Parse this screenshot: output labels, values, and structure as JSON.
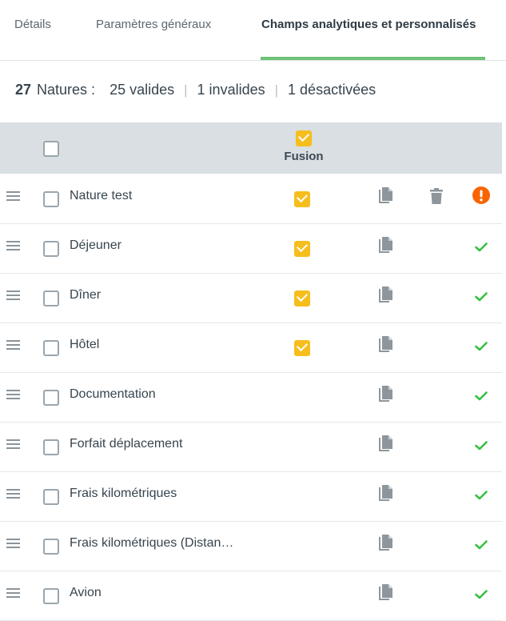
{
  "tabs": [
    {
      "label": "Détails"
    },
    {
      "label": "Paramètres généraux"
    },
    {
      "label": "Champs analytiques et personnalisés",
      "active": true
    }
  ],
  "stats": {
    "count": "27",
    "label": "Natures :",
    "valid": "25 valides",
    "invalid": "1 invalides",
    "disabled": "1 désactivées"
  },
  "table": {
    "fusion_header": "Fusion",
    "fusion_header_checked": true,
    "select_all_checked": false
  },
  "rows": [
    {
      "name": "Nature test",
      "fusion": true,
      "status": "error",
      "deletable": true
    },
    {
      "name": "Déjeuner",
      "fusion": true,
      "status": "valid"
    },
    {
      "name": "Dîner",
      "fusion": true,
      "status": "valid"
    },
    {
      "name": "Hôtel",
      "fusion": true,
      "status": "valid"
    },
    {
      "name": "Documentation",
      "fusion": false,
      "status": "valid"
    },
    {
      "name": "Forfait déplacement",
      "fusion": false,
      "status": "valid"
    },
    {
      "name": "Frais kilométriques",
      "fusion": false,
      "status": "valid"
    },
    {
      "name": "Frais kilométriques (Distan…",
      "fusion": false,
      "status": "valid"
    },
    {
      "name": "Avion",
      "fusion": false,
      "status": "valid"
    }
  ],
  "colors": {
    "accent": "#6cc276",
    "checkbox_checked": "#f6be1d",
    "error": "#fa6400",
    "valid": "#37c143",
    "header_bg": "#d9dfe2"
  },
  "icons": {
    "drag": "drag-handle-icon",
    "copy": "copy-icon",
    "delete": "trash-icon",
    "valid": "checkmark-icon",
    "error": "error-icon"
  }
}
